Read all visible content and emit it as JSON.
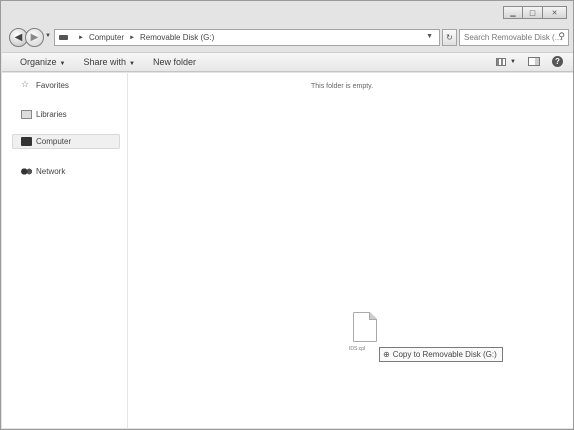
{
  "window": {
    "caption_buttons": [
      {
        "name": "minimize",
        "glyph": "▁"
      },
      {
        "name": "maximize",
        "glyph": "□"
      },
      {
        "name": "close",
        "glyph": "✕"
      }
    ]
  },
  "navigation": {
    "back_glyph": "◀",
    "forward_glyph": "▶",
    "recent_glyph": "▼"
  },
  "address": {
    "crumbs": [
      "Computer",
      "Removable Disk (G:)"
    ],
    "separator": "►",
    "dropdown_glyph": "▼",
    "refresh_glyph": "↻"
  },
  "search": {
    "placeholder": "Search Removable Disk (... ",
    "icon": "⚲"
  },
  "toolbar": {
    "organize": "Organize",
    "share_with": "Share with",
    "new_folder": "New folder",
    "menu_arrow": "▼",
    "views_drop": "▼",
    "help": "?"
  },
  "sidebar": {
    "items": [
      {
        "label": "Favorites",
        "icon": "star-icon"
      },
      {
        "label": "Libraries",
        "icon": "libraries-icon"
      },
      {
        "label": "Computer",
        "icon": "computer-icon"
      },
      {
        "label": "Network",
        "icon": "network-icon"
      }
    ],
    "star_glyph": "☆"
  },
  "content": {
    "empty_message": "This folder is empty."
  },
  "drag": {
    "filename": "IDS.cpl",
    "tooltip": "Copy to Removable Disk (G:)",
    "copy_icon": "⊕"
  }
}
